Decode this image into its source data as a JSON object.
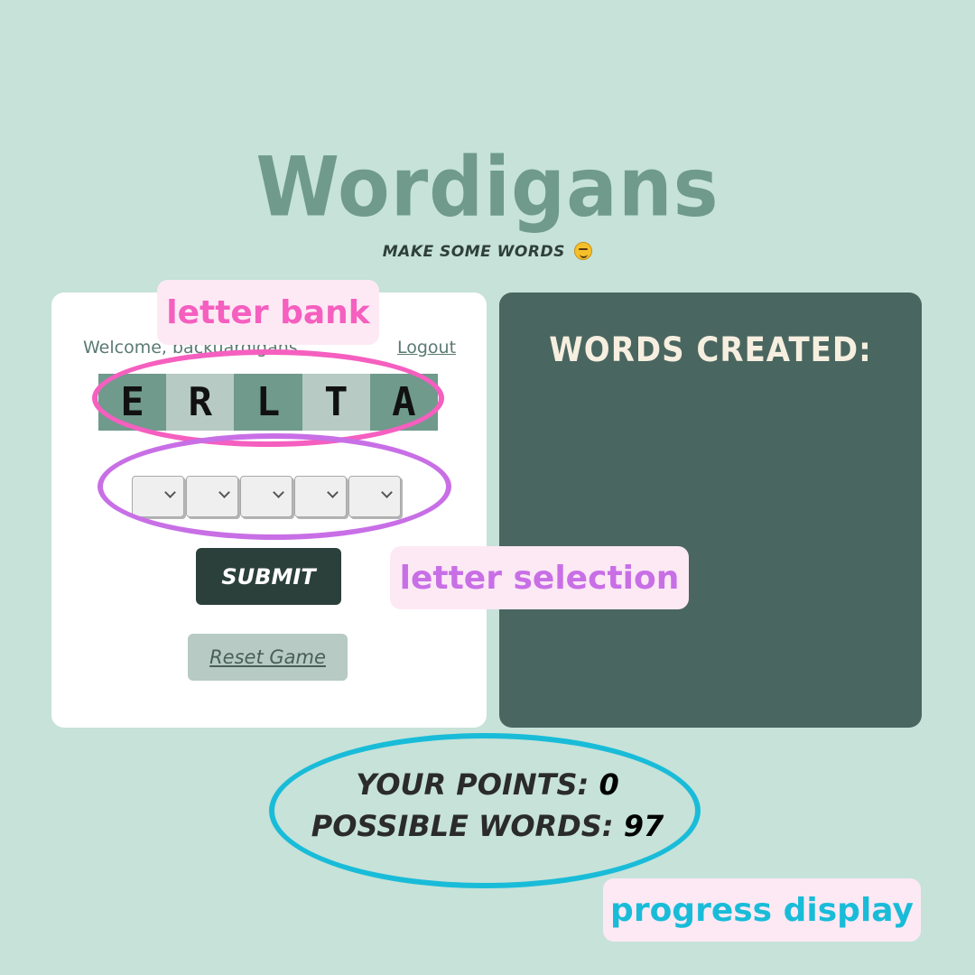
{
  "header": {
    "title": "Wordigans",
    "subtitle": "MAKE SOME WORDS"
  },
  "game": {
    "welcome_text": "Welcome, backuardigans",
    "logout_label": "Logout",
    "letters": [
      "E",
      "R",
      "L",
      "T",
      "A"
    ],
    "submit_label": "SUBMIT",
    "reset_label": "Reset Game"
  },
  "words_panel": {
    "title": "WORDS CREATED:"
  },
  "stats": {
    "points_label": "YOUR POINTS:",
    "points_value": "0",
    "possible_label": "POSSIBLE WORDS:",
    "possible_value": "97"
  },
  "annotations": {
    "letter_bank": "letter bank",
    "letter_selection": "letter selection",
    "progress_display": "progress display"
  },
  "colors": {
    "background": "#c6e2d9",
    "title": "#6f9a8c",
    "panel_dark": "#4a6660",
    "submit": "#2c403b",
    "pink": "#f55fbf",
    "purple": "#c86fe6",
    "blue": "#19bcd8"
  },
  "icons": {
    "subtitle_emoji": "smirk-emoji-icon",
    "select_arrow": "chevron-down-icon"
  }
}
